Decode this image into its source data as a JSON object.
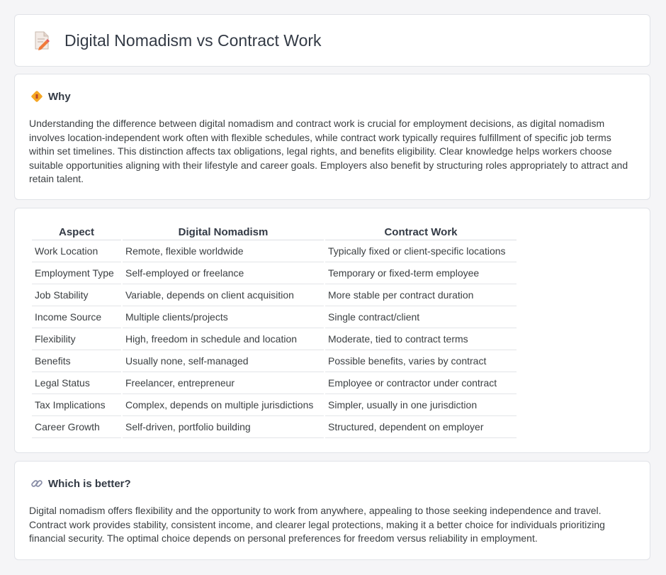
{
  "page": {
    "title": "Digital Nomadism vs Contract Work"
  },
  "why": {
    "title": "Why",
    "text": "Understanding the difference between digital nomadism and contract work is crucial for employment decisions, as digital nomadism involves location-independent work often with flexible schedules, while contract work typically requires fulfillment of specific job terms within set timelines. This distinction affects tax obligations, legal rights, and benefits eligibility. Clear knowledge helps workers choose suitable opportunities aligning with their lifestyle and career goals. Employers also benefit by structuring roles appropriately to attract and retain talent."
  },
  "comparison": {
    "headers": [
      "Aspect",
      "Digital Nomadism",
      "Contract Work"
    ],
    "rows": [
      [
        "Work Location",
        "Remote, flexible worldwide",
        "Typically fixed or client-specific locations"
      ],
      [
        "Employment Type",
        "Self-employed or freelance",
        "Temporary or fixed-term employee"
      ],
      [
        "Job Stability",
        "Variable, depends on client acquisition",
        "More stable per contract duration"
      ],
      [
        "Income Source",
        "Multiple clients/projects",
        "Single contract/client"
      ],
      [
        "Flexibility",
        "High, freedom in schedule and location",
        "Moderate, tied to contract terms"
      ],
      [
        "Benefits",
        "Usually none, self-managed",
        "Possible benefits, varies by contract"
      ],
      [
        "Legal Status",
        "Freelancer, entrepreneur",
        "Employee or contractor under contract"
      ],
      [
        "Tax Implications",
        "Complex, depends on multiple jurisdictions",
        "Simpler, usually in one jurisdiction"
      ],
      [
        "Career Growth",
        "Self-driven, portfolio building",
        "Structured, dependent on employer"
      ]
    ]
  },
  "better": {
    "title": "Which is better?",
    "text": "Digital nomadism offers flexibility and the opportunity to work from anywhere, appealing to those seeking independence and travel. Contract work provides stability, consistent income, and clearer legal protections, making it a better choice for individuals prioritizing financial security. The optimal choice depends on personal preferences for freedom versus reliability in employment."
  },
  "icons": {
    "header": "document-pencil-icon",
    "why": "diamond-sign-icon",
    "better": "link-icon"
  },
  "colors": {
    "background": "#f5f5f7",
    "card": "#ffffff",
    "heading": "#333a45",
    "text": "#3c4043"
  }
}
